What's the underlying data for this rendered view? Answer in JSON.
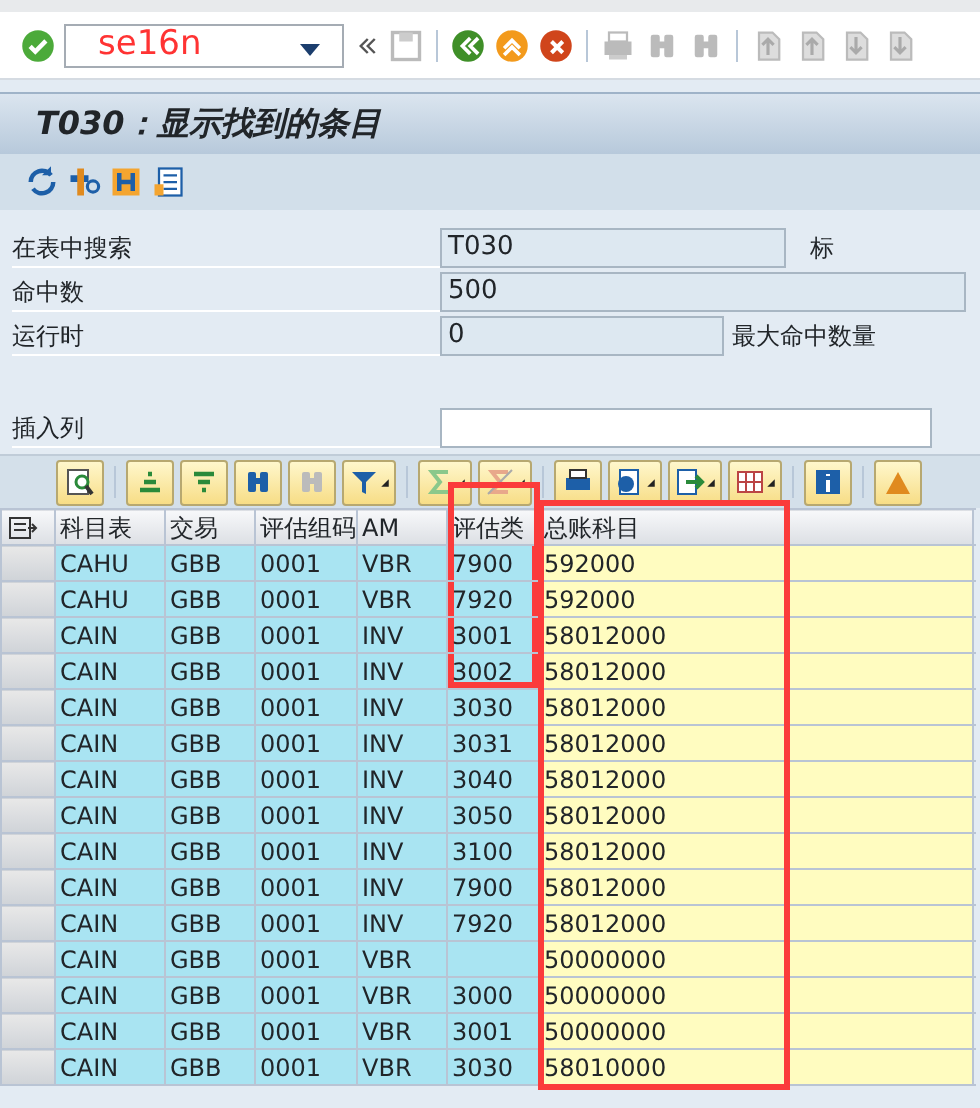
{
  "command_field": {
    "value": "se16n"
  },
  "title": "T030：显示找到的条目",
  "form": [
    {
      "label": "在表中搜索",
      "value": "T030",
      "suffix": "标",
      "kind": "readonly"
    },
    {
      "label": "命中数",
      "value": "500",
      "kind": "readonly"
    },
    {
      "label": "运行时",
      "value": "0",
      "suffix": "最大命中数量",
      "kind": "readonly"
    },
    {
      "label": "插入列",
      "kind": "input"
    }
  ],
  "table": {
    "columns": [
      {
        "label": "科目表",
        "outlined": false,
        "kind": "key"
      },
      {
        "label": "交易",
        "outlined": false,
        "kind": "key"
      },
      {
        "label": "评估组码",
        "outlined": false,
        "kind": "key"
      },
      {
        "label": "AM",
        "outlined": false,
        "kind": "key"
      },
      {
        "label": "评估类",
        "outlined": true,
        "full_height": false,
        "kind": "key"
      },
      {
        "label": "总账科目",
        "outlined": true,
        "full_height": true,
        "kind": "data"
      }
    ],
    "rows": [
      {
        "cells": [
          "CAHU",
          "GBB",
          "0001",
          "VBR",
          "7900",
          "592000"
        ],
        "marked": true
      },
      {
        "cells": [
          "CAHU",
          "GBB",
          "0001",
          "VBR",
          "7920",
          "592000"
        ],
        "marked": true
      },
      {
        "cells": [
          "CAIN",
          "GBB",
          "0001",
          "INV",
          "3001",
          "58012000"
        ],
        "marked": true
      },
      {
        "cells": [
          "CAIN",
          "GBB",
          "0001",
          "INV",
          "3002",
          "58012000"
        ],
        "marked": true
      },
      {
        "cells": [
          "CAIN",
          "GBB",
          "0001",
          "INV",
          "3030",
          "58012000"
        ],
        "marked": false
      },
      {
        "cells": [
          "CAIN",
          "GBB",
          "0001",
          "INV",
          "3031",
          "58012000"
        ],
        "marked": false
      },
      {
        "cells": [
          "CAIN",
          "GBB",
          "0001",
          "INV",
          "3040",
          "58012000"
        ],
        "marked": false
      },
      {
        "cells": [
          "CAIN",
          "GBB",
          "0001",
          "INV",
          "3050",
          "58012000"
        ],
        "marked": false
      },
      {
        "cells": [
          "CAIN",
          "GBB",
          "0001",
          "INV",
          "3100",
          "58012000"
        ],
        "marked": false
      },
      {
        "cells": [
          "CAIN",
          "GBB",
          "0001",
          "INV",
          "7900",
          "58012000"
        ],
        "marked": false
      },
      {
        "cells": [
          "CAIN",
          "GBB",
          "0001",
          "INV",
          "7920",
          "58012000"
        ],
        "marked": false
      },
      {
        "cells": [
          "CAIN",
          "GBB",
          "0001",
          "VBR",
          "",
          "50000000"
        ],
        "marked": false
      },
      {
        "cells": [
          "CAIN",
          "GBB",
          "0001",
          "VBR",
          "3000",
          "50000000"
        ],
        "marked": false
      },
      {
        "cells": [
          "CAIN",
          "GBB",
          "0001",
          "VBR",
          "3001",
          "50000000"
        ],
        "marked": false
      },
      {
        "cells": [
          "CAIN",
          "GBB",
          "0001",
          "VBR",
          "3030",
          "58010000"
        ],
        "marked": false
      }
    ]
  }
}
